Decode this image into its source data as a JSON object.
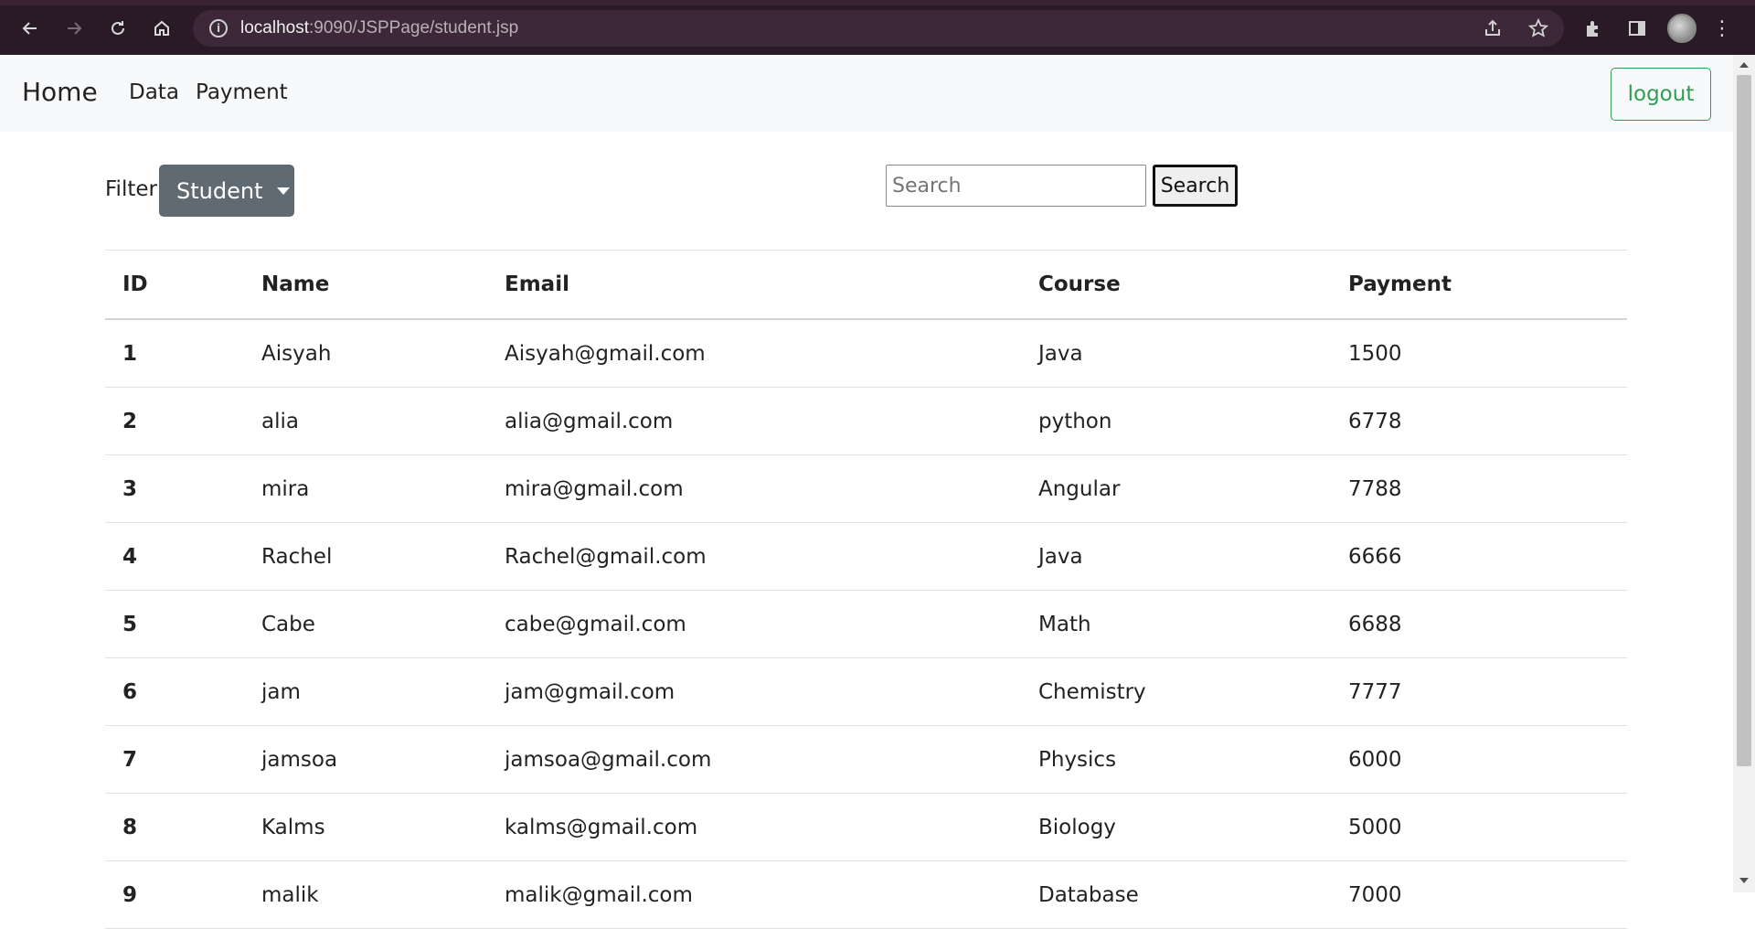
{
  "browser": {
    "url_host": "localhost",
    "url_rest": ":9090/JSPPage/student.jsp",
    "icons": [
      "back-icon",
      "forward-icon",
      "reload-icon",
      "home-icon",
      "info-icon",
      "share-icon",
      "star-icon",
      "extensions-icon",
      "sidepanel-icon",
      "profile-avatar",
      "menu-icon"
    ]
  },
  "navbar": {
    "brand": "Home",
    "links": [
      "Data",
      "Payment"
    ],
    "logout": "logout"
  },
  "filter": {
    "label": "Filter",
    "selected": "Student"
  },
  "search": {
    "placeholder": "Search",
    "button": "Search"
  },
  "table": {
    "headers": [
      "ID",
      "Name",
      "Email",
      "Course",
      "Payment"
    ],
    "rows": [
      [
        "1",
        "Aisyah",
        "Aisyah@gmail.com",
        "Java",
        "1500"
      ],
      [
        "2",
        "alia",
        "alia@gmail.com",
        "python",
        "6778"
      ],
      [
        "3",
        "mira",
        "mira@gmail.com",
        "Angular",
        "7788"
      ],
      [
        "4",
        "Rachel",
        "Rachel@gmail.com",
        "Java",
        "6666"
      ],
      [
        "5",
        "Cabe",
        "cabe@gmail.com",
        "Math",
        "6688"
      ],
      [
        "6",
        "jam",
        "jam@gmail.com",
        "Chemistry",
        "7777"
      ],
      [
        "7",
        "jamsoa",
        "jamsoa@gmail.com",
        "Physics",
        "6000"
      ],
      [
        "8",
        "Kalms",
        "kalms@gmail.com",
        "Biology",
        "5000"
      ],
      [
        "9",
        "malik",
        "malik@gmail.com",
        "Database",
        "7000"
      ]
    ]
  },
  "colors": {
    "browser_frame": "#2a1a26",
    "navbar_bg": "#f8f9fa",
    "logout_green": "#2e9e52",
    "dropdown_gray": "#5f6a73"
  }
}
